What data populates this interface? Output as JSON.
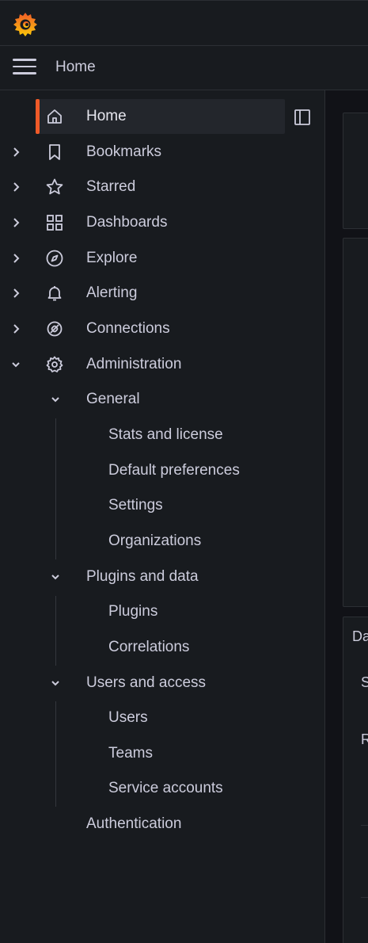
{
  "breadcrumb": {
    "current": "Home"
  },
  "nav": {
    "home": "Home",
    "bookmarks": "Bookmarks",
    "starred": "Starred",
    "dashboards": "Dashboards",
    "explore": "Explore",
    "alerting": "Alerting",
    "connections": "Connections",
    "administration": "Administration",
    "general": "General",
    "stats_license": "Stats and license",
    "default_preferences": "Default preferences",
    "settings": "Settings",
    "organizations": "Organizations",
    "plugins_data": "Plugins and data",
    "plugins": "Plugins",
    "correlations": "Correlations",
    "users_access": "Users and access",
    "users": "Users",
    "teams": "Teams",
    "service_accounts": "Service accounts",
    "authentication": "Authentication"
  },
  "main": {
    "panel_title_fragment": "Da",
    "row1_fragment": "S",
    "row2_fragment": "R"
  },
  "colors": {
    "accent": "#f05a28",
    "background": "#111217",
    "sidebar": "#181b1f",
    "text": "#ccccdc"
  },
  "icons": [
    "grafana-logo-icon",
    "hamburger-icon",
    "home-icon",
    "dock-icon",
    "bookmark-icon",
    "star-icon",
    "apps-icon",
    "compass-icon",
    "bell-icon",
    "plug-icon",
    "gear-icon",
    "chevron-right-icon",
    "chevron-down-icon"
  ]
}
